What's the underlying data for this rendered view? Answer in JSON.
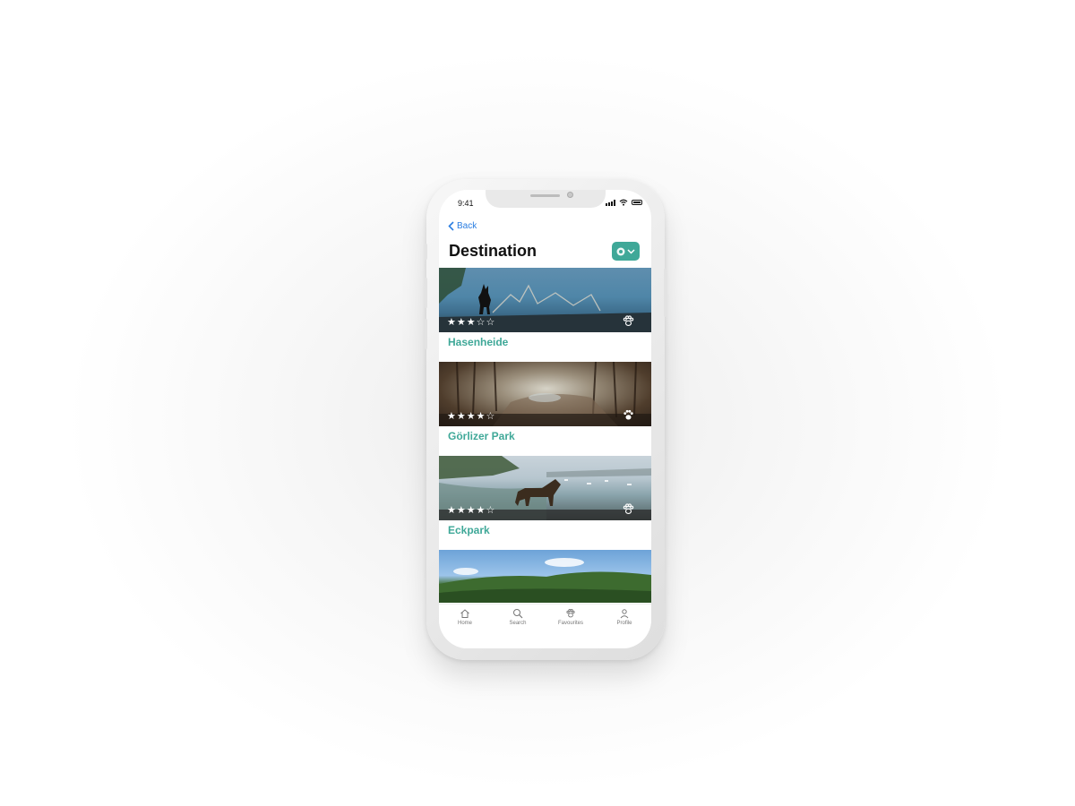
{
  "status_bar": {
    "time": "9:41"
  },
  "nav": {
    "back_label": "Back"
  },
  "header": {
    "title": "Destination"
  },
  "colors": {
    "accent": "#3fa898",
    "link": "#2a7de1"
  },
  "destinations": [
    {
      "name": "Hasenheide",
      "rating": 3,
      "max_rating": 5,
      "stars_text": "★★★☆☆",
      "favourite": false
    },
    {
      "name": "Görlizer Park",
      "rating": 4,
      "max_rating": 5,
      "stars_text": "★★★★☆",
      "favourite": true
    },
    {
      "name": "Eckpark",
      "rating": 4,
      "max_rating": 5,
      "stars_text": "★★★★☆",
      "favourite": false
    },
    {
      "name": "",
      "rating": null,
      "favourite": false
    }
  ],
  "tabbar": {
    "items": [
      {
        "label": "Home",
        "icon": "home-icon"
      },
      {
        "label": "Search",
        "icon": "search-icon"
      },
      {
        "label": "Favourites",
        "icon": "paw-icon"
      },
      {
        "label": "Profile",
        "icon": "profile-icon"
      }
    ]
  }
}
